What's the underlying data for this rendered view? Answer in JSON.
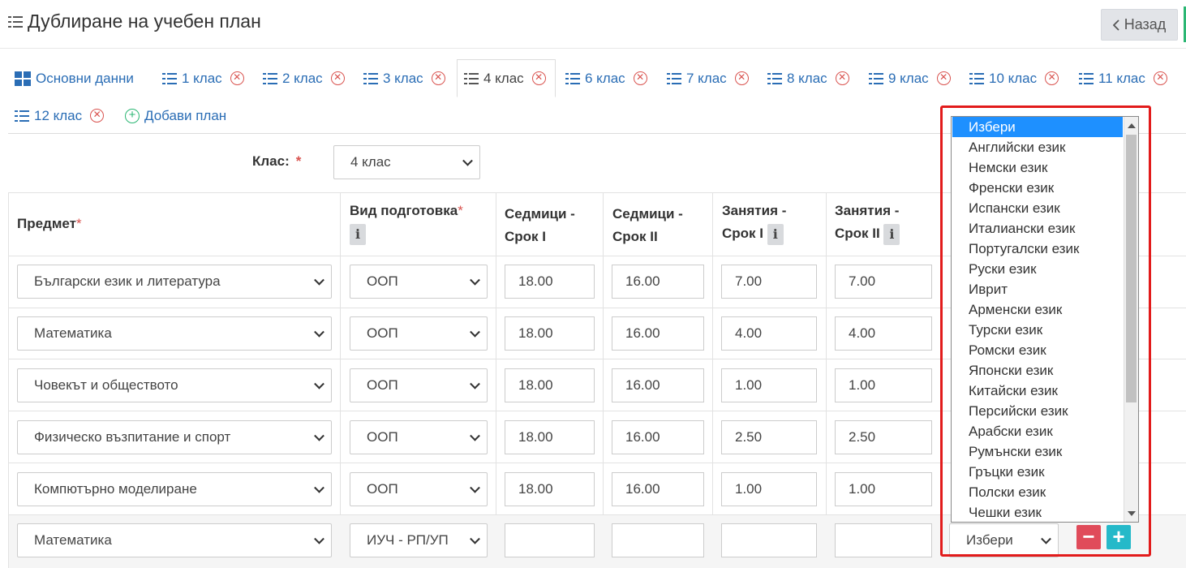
{
  "header": {
    "title": "Дублиране на учебен план",
    "back_label": "Назад"
  },
  "tabs": [
    {
      "label": "Основни данни"
    },
    {
      "label": "1 клас"
    },
    {
      "label": "2 клас"
    },
    {
      "label": "3 клас"
    },
    {
      "label": "4 клас"
    },
    {
      "label": "6 клас"
    },
    {
      "label": "7 клас"
    },
    {
      "label": "8 клас"
    },
    {
      "label": "9 клас"
    },
    {
      "label": "10 клас"
    },
    {
      "label": "11 клас"
    },
    {
      "label": "12 клас"
    },
    {
      "label": "Добави план"
    }
  ],
  "class_field": {
    "label": "Клас:",
    "required": "*",
    "value": "4 клас"
  },
  "table": {
    "headers": {
      "subject": "Предмет",
      "prep_line1": "Вид подготовка",
      "weeks1_line1": "Седмици -",
      "weeks1_line2": "Срок I",
      "weeks2_line1": "Седмици -",
      "weeks2_line2": "Срок II",
      "classes1_line1": "Занятия -",
      "classes1_line2": "Срок I",
      "classes2_line1": "Занятия -",
      "classes2_line2": "Срок II",
      "required": "*",
      "info": "i"
    },
    "rows": [
      {
        "subject": "Български език и литература",
        "prep": "ООП",
        "weeks1": "18.00",
        "weeks2": "16.00",
        "classes1": "7.00",
        "classes2": "7.00"
      },
      {
        "subject": "Математика",
        "prep": "ООП",
        "weeks1": "18.00",
        "weeks2": "16.00",
        "classes1": "4.00",
        "classes2": "4.00"
      },
      {
        "subject": "Човекът и обществото",
        "prep": "ООП",
        "weeks1": "18.00",
        "weeks2": "16.00",
        "classes1": "1.00",
        "classes2": "1.00"
      },
      {
        "subject": "Физическо възпитание и спорт",
        "prep": "ООП",
        "weeks1": "18.00",
        "weeks2": "16.00",
        "classes1": "2.50",
        "classes2": "2.50"
      },
      {
        "subject": "Компютърно моделиране",
        "prep": "ООП",
        "weeks1": "18.00",
        "weeks2": "16.00",
        "classes1": "1.00",
        "classes2": "1.00"
      },
      {
        "subject": "Математика",
        "prep": "ИУЧ - РП/УП",
        "weeks1": "",
        "weeks2": "",
        "classes1": "",
        "classes2": "",
        "language": "Избери"
      }
    ]
  },
  "language_dropdown": {
    "options": [
      "Избери",
      "Английски език",
      "Немски език",
      "Френски език",
      "Испански език",
      "Италиански език",
      "Португалски език",
      "Руски език",
      "Иврит",
      "Арменски език",
      "Турски език",
      "Ромски език",
      "Японски език",
      "Китайски език",
      "Персийски език",
      "Арабски език",
      "Румънски език",
      "Гръцки език",
      "Полски език",
      "Чешки език"
    ],
    "selected_index": 0
  },
  "row_actions": {
    "remove": "−",
    "add": "+"
  },
  "colors": {
    "link": "#2a6db5",
    "danger": "#e04b5a",
    "info": "#25b9c9",
    "highlight": "#e21b1b",
    "selected": "#1e90ff"
  }
}
